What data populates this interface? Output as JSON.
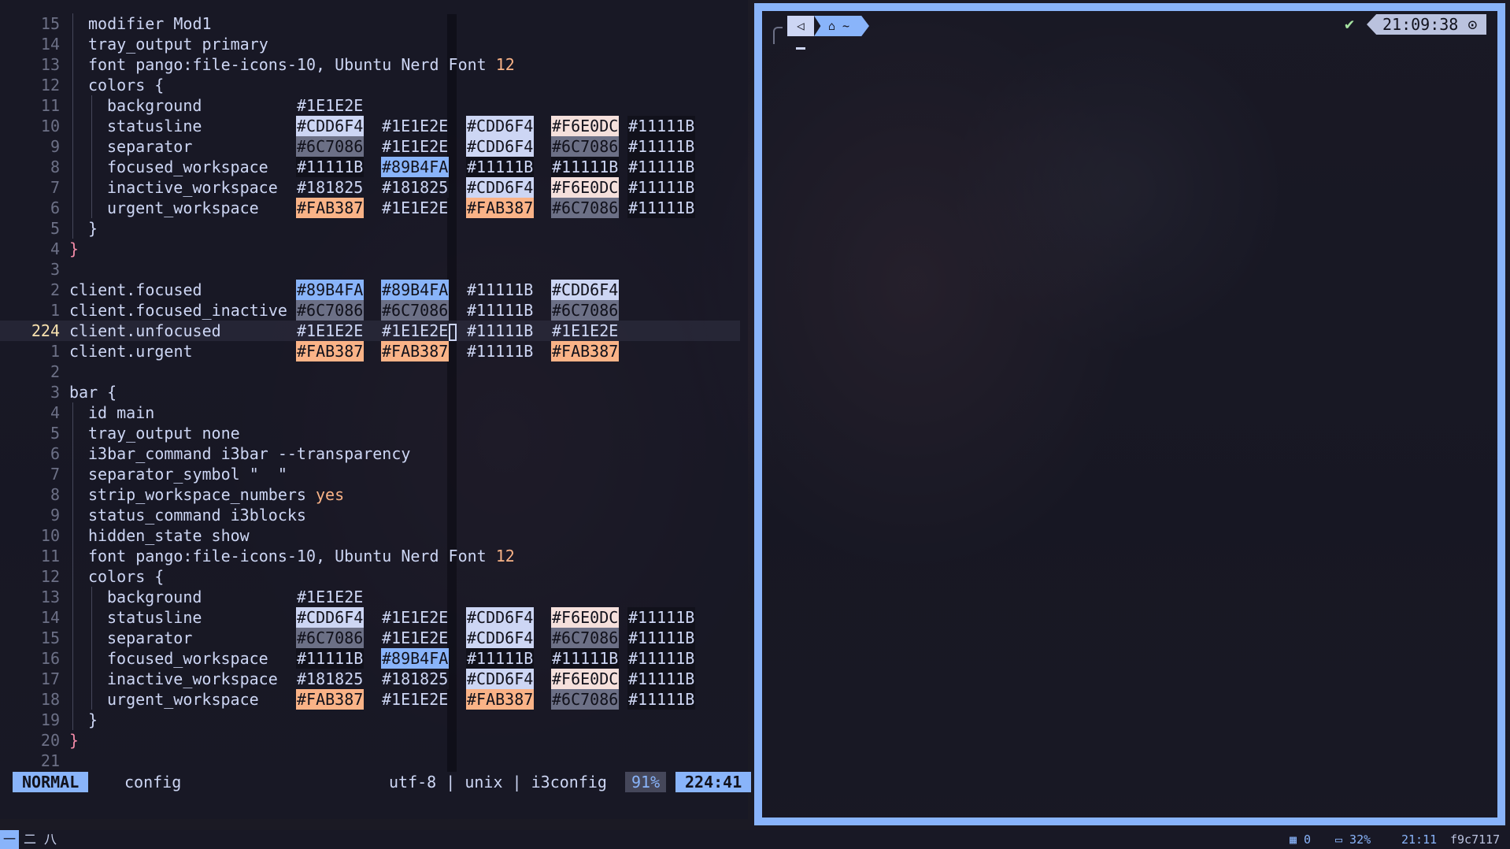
{
  "editor": {
    "lines": [
      {
        "num": "15",
        "indent": 1,
        "text": "modifier Mod1"
      },
      {
        "num": "14",
        "indent": 1,
        "text": "tray_output primary"
      },
      {
        "num": "13",
        "indent": 1,
        "text": "font pango:file-icons-10, Ubuntu Nerd Font ",
        "num_tail": "12"
      },
      {
        "num": "12",
        "indent": 1,
        "text": "colors {"
      },
      {
        "num": "11",
        "indent": 2,
        "text": "background",
        "cols": [
          {
            "v": "#1E1E2E",
            "bg": ""
          }
        ]
      },
      {
        "num": "10",
        "indent": 2,
        "text": "statusline",
        "cols": [
          {
            "v": "#CDD6F4",
            "bg": "#CDD6F4"
          },
          {
            "v": "#1E1E2E",
            "bg": ""
          },
          {
            "v": "#CDD6F4",
            "bg": "#CDD6F4"
          },
          {
            "v": "#F6E0DC",
            "bg": "#F5E0DC"
          },
          {
            "v": "#11111B",
            "bg": "#11111B"
          }
        ]
      },
      {
        "num": "9",
        "indent": 2,
        "text": "separator",
        "cols": [
          {
            "v": "#6C7086",
            "bg": "#6C7086"
          },
          {
            "v": "#1E1E2E",
            "bg": ""
          },
          {
            "v": "#CDD6F4",
            "bg": "#CDD6F4"
          },
          {
            "v": "#6C7086",
            "bg": "#6C7086"
          },
          {
            "v": "#11111B",
            "bg": "#11111B"
          }
        ]
      },
      {
        "num": "8",
        "indent": 2,
        "text": "focused_workspace",
        "cols": [
          {
            "v": "#11111B",
            "bg": "#11111B"
          },
          {
            "v": "#89B4FA",
            "bg": "#89B4FA"
          },
          {
            "v": "#11111B",
            "bg": "#11111B"
          },
          {
            "v": "#11111B",
            "bg": "#11111B"
          },
          {
            "v": "#11111B",
            "bg": "#11111B"
          }
        ]
      },
      {
        "num": "7",
        "indent": 2,
        "text": "inactive_workspace",
        "cols": [
          {
            "v": "#181825",
            "bg": "#181825"
          },
          {
            "v": "#181825",
            "bg": "#181825"
          },
          {
            "v": "#CDD6F4",
            "bg": "#CDD6F4"
          },
          {
            "v": "#F6E0DC",
            "bg": "#F5E0DC"
          },
          {
            "v": "#11111B",
            "bg": "#11111B"
          }
        ]
      },
      {
        "num": "6",
        "indent": 2,
        "text": "urgent_workspace",
        "cols": [
          {
            "v": "#FAB387",
            "bg": "#FAB387"
          },
          {
            "v": "#1E1E2E",
            "bg": ""
          },
          {
            "v": "#FAB387",
            "bg": "#FAB387"
          },
          {
            "v": "#6C7086",
            "bg": "#6C7086"
          },
          {
            "v": "#11111B",
            "bg": "#11111B"
          }
        ]
      },
      {
        "num": "5",
        "indent": 1,
        "text": "}"
      },
      {
        "num": "4",
        "indent": 0,
        "text": "}",
        "red": true
      },
      {
        "num": "3",
        "indent": 0,
        "text": ""
      },
      {
        "num": "2",
        "indent": 0,
        "text": "client.focused",
        "cols": [
          {
            "v": "#89B4FA",
            "bg": "#89B4FA"
          },
          {
            "v": "#89B4FA",
            "bg": "#89B4FA"
          },
          {
            "v": "#11111B",
            "bg": ""
          },
          {
            "v": "#CDD6F4",
            "bg": "#CDD6F4"
          }
        ]
      },
      {
        "num": "1",
        "indent": 0,
        "text": "client.focused_inactive",
        "cols": [
          {
            "v": "#6C7086",
            "bg": "#6C7086"
          },
          {
            "v": "#6C7086",
            "bg": "#6C7086"
          },
          {
            "v": "#11111B",
            "bg": ""
          },
          {
            "v": "#6C7086",
            "bg": "#6C7086"
          }
        ]
      },
      {
        "num": "224",
        "indent": 0,
        "text": "client.unfocused",
        "current": true,
        "cols": [
          {
            "v": "#1E1E2E",
            "bg": ""
          },
          {
            "v": "#1E1E2E",
            "bg": "",
            "cursor": true
          },
          {
            "v": "#11111B",
            "bg": ""
          },
          {
            "v": "#1E1E2E",
            "bg": ""
          }
        ]
      },
      {
        "num": "1",
        "indent": 0,
        "text": "client.urgent",
        "cols": [
          {
            "v": "#FAB387",
            "bg": "#FAB387"
          },
          {
            "v": "#FAB387",
            "bg": "#FAB387"
          },
          {
            "v": "#11111B",
            "bg": ""
          },
          {
            "v": "#FAB387",
            "bg": "#FAB387"
          }
        ]
      },
      {
        "num": "2",
        "indent": 0,
        "text": ""
      },
      {
        "num": "3",
        "indent": 0,
        "text": "bar {"
      },
      {
        "num": "4",
        "indent": 1,
        "text": "id main"
      },
      {
        "num": "5",
        "indent": 1,
        "text": "tray_output none"
      },
      {
        "num": "6",
        "indent": 1,
        "text": "i3bar_command i3bar --transparency"
      },
      {
        "num": "7",
        "indent": 1,
        "text": "separator_symbol \"  \""
      },
      {
        "num": "8",
        "indent": 1,
        "text": "strip_workspace_numbers ",
        "kw_tail": "yes"
      },
      {
        "num": "9",
        "indent": 1,
        "text": "status_command i3blocks"
      },
      {
        "num": "10",
        "indent": 1,
        "text": "hidden_state show"
      },
      {
        "num": "11",
        "indent": 1,
        "text": "font pango:file-icons-10, Ubuntu Nerd Font ",
        "num_tail": "12"
      },
      {
        "num": "12",
        "indent": 1,
        "text": "colors {"
      },
      {
        "num": "13",
        "indent": 2,
        "text": "background",
        "cols": [
          {
            "v": "#1E1E2E",
            "bg": ""
          }
        ]
      },
      {
        "num": "14",
        "indent": 2,
        "text": "statusline",
        "cols": [
          {
            "v": "#CDD6F4",
            "bg": "#CDD6F4"
          },
          {
            "v": "#1E1E2E",
            "bg": ""
          },
          {
            "v": "#CDD6F4",
            "bg": "#CDD6F4"
          },
          {
            "v": "#F6E0DC",
            "bg": "#F5E0DC"
          },
          {
            "v": "#11111B",
            "bg": "#11111B"
          }
        ]
      },
      {
        "num": "15",
        "indent": 2,
        "text": "separator",
        "cols": [
          {
            "v": "#6C7086",
            "bg": "#6C7086"
          },
          {
            "v": "#1E1E2E",
            "bg": ""
          },
          {
            "v": "#CDD6F4",
            "bg": "#CDD6F4"
          },
          {
            "v": "#6C7086",
            "bg": "#6C7086"
          },
          {
            "v": "#11111B",
            "bg": "#11111B"
          }
        ]
      },
      {
        "num": "16",
        "indent": 2,
        "text": "focused_workspace",
        "cols": [
          {
            "v": "#11111B",
            "bg": "#11111B"
          },
          {
            "v": "#89B4FA",
            "bg": "#89B4FA"
          },
          {
            "v": "#11111B",
            "bg": "#11111B"
          },
          {
            "v": "#11111B",
            "bg": "#11111B"
          },
          {
            "v": "#11111B",
            "bg": "#11111B"
          }
        ]
      },
      {
        "num": "17",
        "indent": 2,
        "text": "inactive_workspace",
        "cols": [
          {
            "v": "#181825",
            "bg": "#181825"
          },
          {
            "v": "#181825",
            "bg": "#181825"
          },
          {
            "v": "#CDD6F4",
            "bg": "#CDD6F4"
          },
          {
            "v": "#F6E0DC",
            "bg": "#F5E0DC"
          },
          {
            "v": "#11111B",
            "bg": "#11111B"
          }
        ]
      },
      {
        "num": "18",
        "indent": 2,
        "text": "urgent_workspace",
        "cols": [
          {
            "v": "#FAB387",
            "bg": "#FAB387"
          },
          {
            "v": "#1E1E2E",
            "bg": ""
          },
          {
            "v": "#FAB387",
            "bg": "#FAB387"
          },
          {
            "v": "#6C7086",
            "bg": "#6C7086"
          },
          {
            "v": "#11111B",
            "bg": "#11111B"
          }
        ]
      },
      {
        "num": "19",
        "indent": 1,
        "text": "}"
      },
      {
        "num": "20",
        "indent": 0,
        "text": "}",
        "red": true
      },
      {
        "num": "21",
        "indent": 0,
        "text": ""
      }
    ]
  },
  "statusline": {
    "mode": "NORMAL",
    "filename": "config",
    "encoding": "utf-8 | unix | i3config",
    "percent": "91%",
    "position": "224:41"
  },
  "terminal": {
    "seg_home_icon": "⌂ ~",
    "seg_arrow_icon": "◁",
    "check": "✔",
    "clock": "21:09:38 ⊙"
  },
  "i3bar": {
    "workspaces": [
      {
        "label": "一",
        "active": true
      },
      {
        "label": "二",
        "active": false
      },
      {
        "label": "八",
        "active": false
      }
    ],
    "blocks": {
      "windows": "▦ 0",
      "battery": "▭ 32%",
      "time": "21:11",
      "commit": "f9c7117"
    }
  },
  "colors": {
    "accent": "#89B4FA",
    "background": "#1E1E2E",
    "text": "#CDD6F4"
  }
}
